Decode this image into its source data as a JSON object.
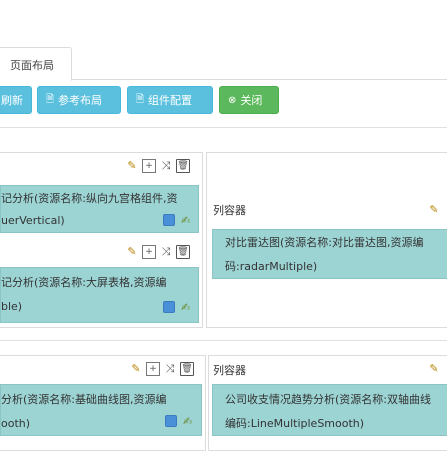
{
  "tab": {
    "label": "页面布局"
  },
  "toolbar": {
    "refresh_label": "刷新",
    "reference_label": "参考布局",
    "component_config_label": "组件配置",
    "close_label": "关闭"
  },
  "row1": {
    "left_component_line1": "记分析(资源名称:纵向九宫格组件,资",
    "left_component_line2": "uerVertical)",
    "left_component2_line1": "记分析(资源名称:大屏表格,资源编",
    "left_component2_line2": "ble)",
    "right_container_label": "列容器",
    "right_component_line1": "对比雷达图(资源名称:对比雷达图,资源编",
    "right_component_line2": "码:radarMultiple)"
  },
  "row2": {
    "left_component_line1": "分析(资源名称:基础曲线图,资源编",
    "left_component_line2": "ooth)",
    "right_container_label": "列容器",
    "right_component_line1": "公司收支情况趋势分析(资源名称:双轴曲线",
    "right_component_line2": "编码:LineMultipleSmooth)"
  }
}
